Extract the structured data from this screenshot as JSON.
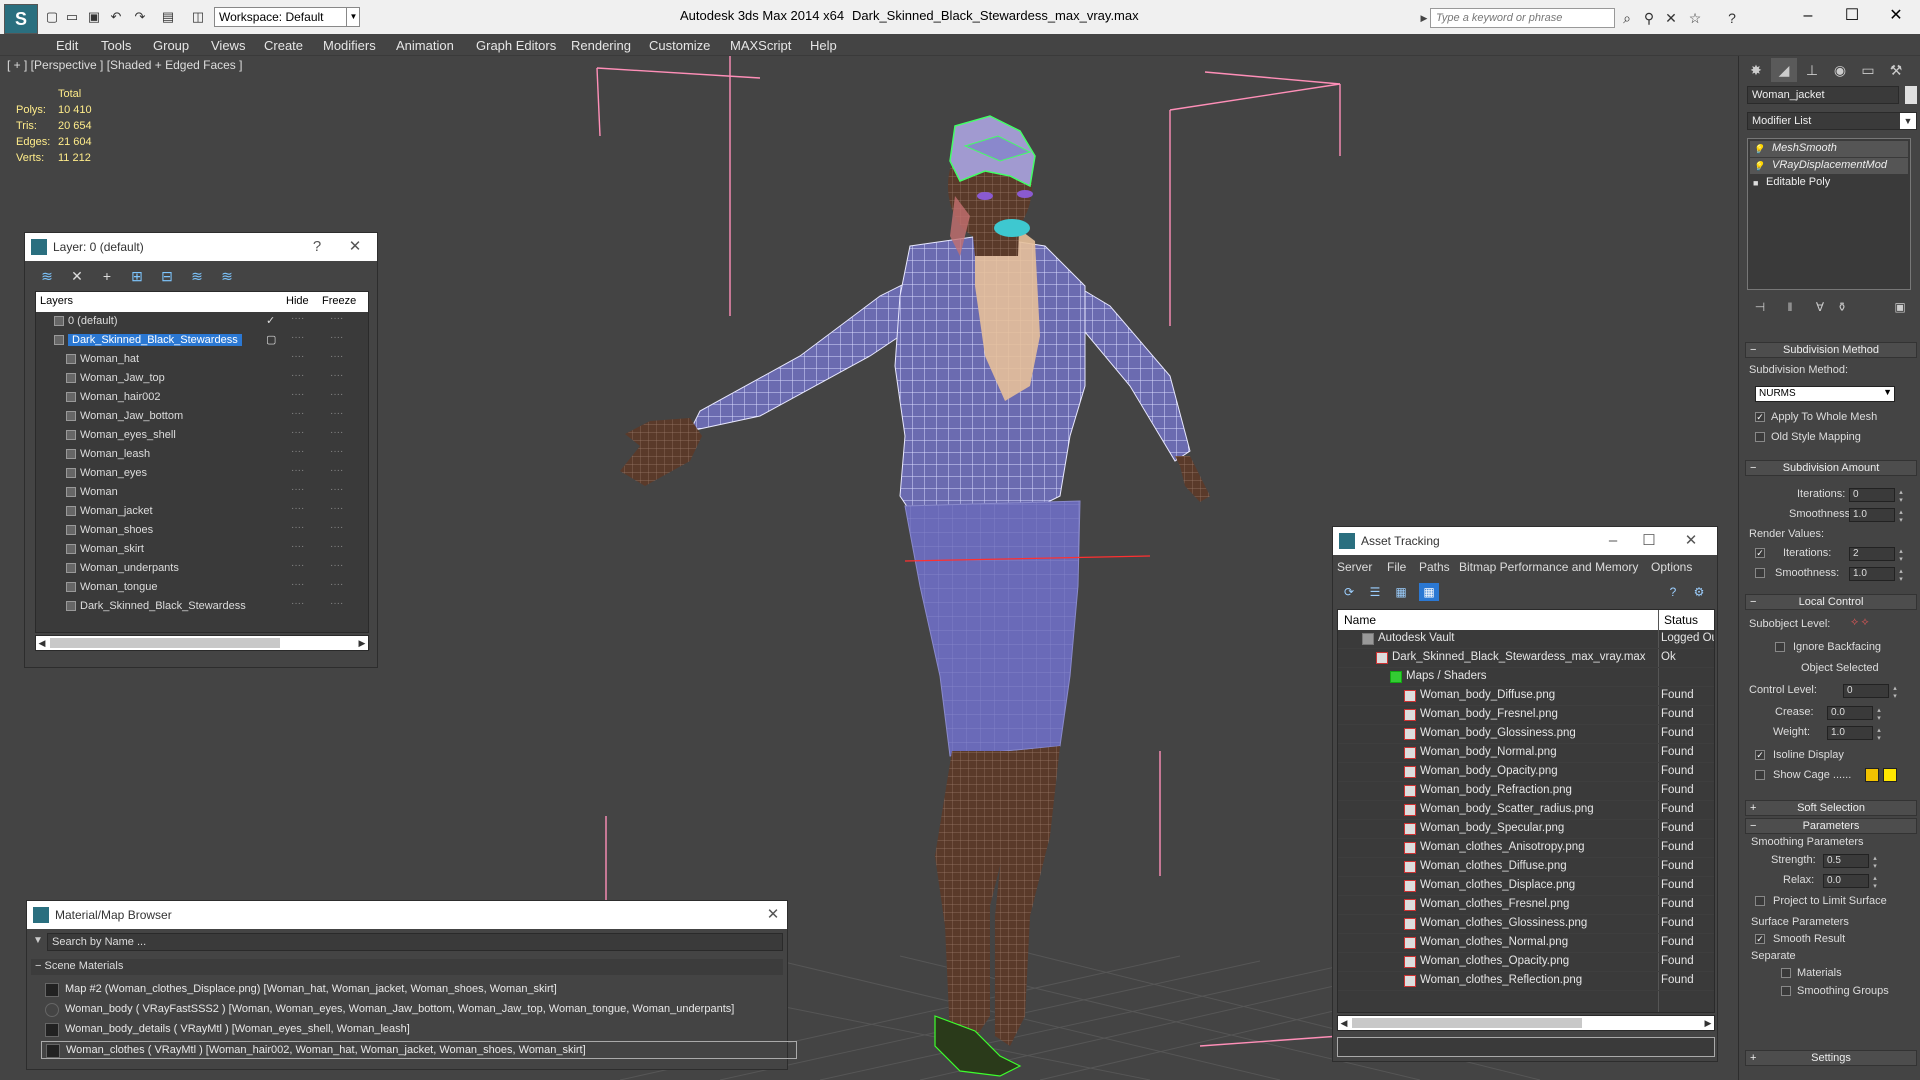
{
  "titlebar": {
    "workspace": "Workspace: Default",
    "app_title": "Autodesk 3ds Max  2014 x64",
    "file_name": "Dark_Skinned_Black_Stewardess_max_vray.max",
    "search_placeholder": "Type a keyword or phrase"
  },
  "menu": [
    "Edit",
    "Tools",
    "Group",
    "Views",
    "Create",
    "Modifiers",
    "Animation",
    "Graph Editors",
    "Rendering",
    "Customize",
    "MAXScript",
    "Help"
  ],
  "viewport": {
    "label": "[ + ] [Perspective ] [Shaded + Edged Faces ]",
    "stats": {
      "header": "Total",
      "rows": [
        {
          "label": "Polys:",
          "value": "10 410"
        },
        {
          "label": "Tris:",
          "value": "20 654"
        },
        {
          "label": "Edges:",
          "value": "21 604"
        },
        {
          "label": "Verts:",
          "value": "11 212"
        }
      ]
    }
  },
  "layer_panel": {
    "title": "Layer: 0 (default)",
    "help": "?",
    "columns": {
      "layers": "Layers",
      "hide": "Hide",
      "freeze": "Freeze"
    },
    "rows": [
      {
        "name": "0 (default)",
        "level": 1,
        "check": "✓"
      },
      {
        "name": "Dark_Skinned_Black_Stewardess",
        "level": 1,
        "selected": true,
        "check": "▢"
      },
      {
        "name": "Woman_hat",
        "level": 2
      },
      {
        "name": "Woman_Jaw_top",
        "level": 2
      },
      {
        "name": "Woman_hair002",
        "level": 2
      },
      {
        "name": "Woman_Jaw_bottom",
        "level": 2
      },
      {
        "name": "Woman_eyes_shell",
        "level": 2
      },
      {
        "name": "Woman_leash",
        "level": 2
      },
      {
        "name": "Woman_eyes",
        "level": 2
      },
      {
        "name": "Woman",
        "level": 2
      },
      {
        "name": "Woman_jacket",
        "level": 2
      },
      {
        "name": "Woman_shoes",
        "level": 2
      },
      {
        "name": "Woman_skirt",
        "level": 2
      },
      {
        "name": "Woman_underpants",
        "level": 2
      },
      {
        "name": "Woman_tongue",
        "level": 2
      },
      {
        "name": "Dark_Skinned_Black_Stewardess",
        "level": 2
      }
    ]
  },
  "material_browser": {
    "title": "Material/Map Browser",
    "search_placeholder": "Search by Name ...",
    "section": "Scene Materials",
    "rows": [
      "Map #2 (Woman_clothes_Displace.png) [Woman_hat, Woman_jacket, Woman_shoes, Woman_skirt]",
      "Woman_body  ( VRayFastSSS2 ) [Woman, Woman_eyes, Woman_Jaw_bottom, Woman_Jaw_top, Woman_tongue, Woman_underpants]",
      "Woman_body_details  ( VRayMtl ) [Woman_eyes_shell, Woman_leash]",
      "Woman_clothes  ( VRayMtl ) [Woman_hair002, Woman_hat, Woman_jacket, Woman_shoes, Woman_skirt]"
    ]
  },
  "asset_tracking": {
    "title": "Asset Tracking",
    "menu": [
      "Server",
      "File",
      "Paths",
      "Bitmap Performance and Memory",
      "Options"
    ],
    "columns": {
      "name": "Name",
      "status": "Status"
    },
    "rows": [
      {
        "name": "Autodesk Vault",
        "status": "Logged Ou",
        "indent": 0
      },
      {
        "name": "Dark_Skinned_Black_Stewardess_max_vray.max",
        "status": "Ok",
        "indent": 1
      },
      {
        "name": "Maps / Shaders",
        "status": "",
        "indent": 2
      },
      {
        "name": "Woman_body_Diffuse.png",
        "status": "Found",
        "indent": 3
      },
      {
        "name": "Woman_body_Fresnel.png",
        "status": "Found",
        "indent": 3
      },
      {
        "name": "Woman_body_Glossiness.png",
        "status": "Found",
        "indent": 3
      },
      {
        "name": "Woman_body_Normal.png",
        "status": "Found",
        "indent": 3
      },
      {
        "name": "Woman_body_Opacity.png",
        "status": "Found",
        "indent": 3
      },
      {
        "name": "Woman_body_Refraction.png",
        "status": "Found",
        "indent": 3
      },
      {
        "name": "Woman_body_Scatter_radius.png",
        "status": "Found",
        "indent": 3
      },
      {
        "name": "Woman_body_Specular.png",
        "status": "Found",
        "indent": 3
      },
      {
        "name": "Woman_clothes_Anisotropy.png",
        "status": "Found",
        "indent": 3
      },
      {
        "name": "Woman_clothes_Diffuse.png",
        "status": "Found",
        "indent": 3
      },
      {
        "name": "Woman_clothes_Displace.png",
        "status": "Found",
        "indent": 3
      },
      {
        "name": "Woman_clothes_Fresnel.png",
        "status": "Found",
        "indent": 3
      },
      {
        "name": "Woman_clothes_Glossiness.png",
        "status": "Found",
        "indent": 3
      },
      {
        "name": "Woman_clothes_Normal.png",
        "status": "Found",
        "indent": 3
      },
      {
        "name": "Woman_clothes_Opacity.png",
        "status": "Found",
        "indent": 3
      },
      {
        "name": "Woman_clothes_Reflection.png",
        "status": "Found",
        "indent": 3
      }
    ]
  },
  "command_panel": {
    "object_name": "Woman_jacket",
    "modifier_list": "Modifier List",
    "stack": [
      {
        "name": "MeshSmooth",
        "type": "mod"
      },
      {
        "name": "VRayDisplacementMod",
        "type": "mod"
      },
      {
        "name": "Editable Poly",
        "type": "base"
      }
    ],
    "rollouts": {
      "subdivision_method": "Subdivision Method",
      "subdivision_amount": "Subdivision Amount",
      "local_control": "Local Control",
      "soft_selection": "Soft Selection",
      "parameters": "Parameters",
      "settings": "Settings"
    },
    "labels": {
      "subdivision_method": "Subdivision Method:",
      "nurms": "NURMS",
      "apply_whole_mesh": "Apply To Whole Mesh",
      "old_style_mapping": "Old Style Mapping",
      "iterations": "Iterations:",
      "smoothness": "Smoothness:",
      "render_values": "Render Values:",
      "subobject_level": "Subobject Level:",
      "ignore_backfacing": "Ignore Backfacing",
      "object_selected": "Object Selected",
      "control_level": "Control Level:",
      "crease": "Crease:",
      "weight": "Weight:",
      "isoline_display": "Isoline Display",
      "show_cage": "Show Cage ......",
      "smoothing_parameters": "Smoothing Parameters",
      "strength": "Strength:",
      "relax": "Relax:",
      "project_limit": "Project to Limit Surface",
      "surface_parameters": "Surface Parameters",
      "smooth_result": "Smooth Result",
      "separate": "Separate",
      "materials": "Materials",
      "smoothing_groups": "Smoothing Groups"
    },
    "values": {
      "iterations": "0",
      "smoothness": "1.0",
      "render_iterations": "2",
      "render_smoothness": "1.0",
      "control_level": "0",
      "crease": "0.0",
      "weight": "1.0",
      "strength": "0.5",
      "relax": "0.0"
    },
    "cage_colors": [
      "#f2c200",
      "#ffe600"
    ]
  }
}
